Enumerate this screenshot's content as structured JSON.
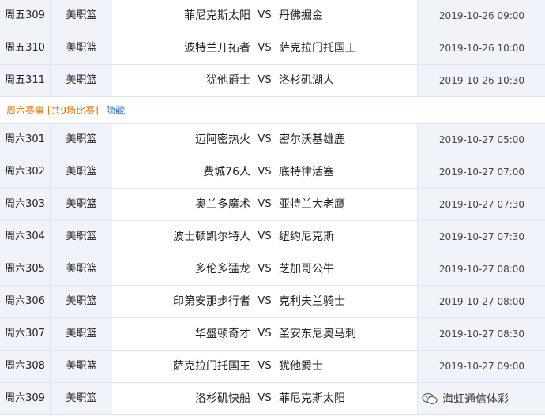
{
  "rows_top": [
    {
      "num": "周五309",
      "league": "美职篮",
      "home": "菲尼克斯太阳",
      "vs": "VS",
      "away": "丹佛掘金",
      "time": "2019-10-26 09:00"
    },
    {
      "num": "周五310",
      "league": "美职篮",
      "home": "波特兰开拓者",
      "vs": "VS",
      "away": "萨克拉门托国王",
      "time": "2019-10-26 10:00"
    },
    {
      "num": "周五311",
      "league": "美职篮",
      "home": "犹他爵士",
      "vs": "VS",
      "away": "洛杉矶湖人",
      "time": "2019-10-26 10:30"
    }
  ],
  "group": {
    "title": "周六赛事 [共9场比赛]",
    "toggle": "隐藏"
  },
  "rows_bottom": [
    {
      "num": "周六301",
      "league": "美职篮",
      "home": "迈阿密热火",
      "vs": "VS",
      "away": "密尔沃基雄鹿",
      "time": "2019-10-27 05:00"
    },
    {
      "num": "周六302",
      "league": "美职篮",
      "home": "费城76人",
      "vs": "VS",
      "away": "底特律活塞",
      "time": "2019-10-27 07:00"
    },
    {
      "num": "周六303",
      "league": "美职篮",
      "home": "奥兰多魔术",
      "vs": "VS",
      "away": "亚特兰大老鹰",
      "time": "2019-10-27 07:30"
    },
    {
      "num": "周六304",
      "league": "美职篮",
      "home": "波士顿凯尔特人",
      "vs": "VS",
      "away": "纽约尼克斯",
      "time": "2019-10-27 07:30"
    },
    {
      "num": "周六305",
      "league": "美职篮",
      "home": "多伦多猛龙",
      "vs": "VS",
      "away": "芝加哥公牛",
      "time": "2019-10-27 08:00"
    },
    {
      "num": "周六306",
      "league": "美职篮",
      "home": "印第安那步行者",
      "vs": "VS",
      "away": "克利夫兰骑士",
      "time": "2019-10-27 08:00"
    },
    {
      "num": "周六307",
      "league": "美职篮",
      "home": "华盛顿奇才",
      "vs": "VS",
      "away": "圣安东尼奥马刺",
      "time": "2019-10-27 08:30"
    },
    {
      "num": "周六308",
      "league": "美职篮",
      "home": "萨克拉门托国王",
      "vs": "VS",
      "away": "犹他爵士",
      "time": "2019-10-27 09:00"
    },
    {
      "num": "周六309",
      "league": "美职篮",
      "home": "洛杉矶快船",
      "vs": "VS",
      "away": "菲尼克斯太阳",
      "time": ""
    }
  ],
  "watermark": {
    "text": "海虹通信体彩",
    "icon": "wechat-icon"
  }
}
